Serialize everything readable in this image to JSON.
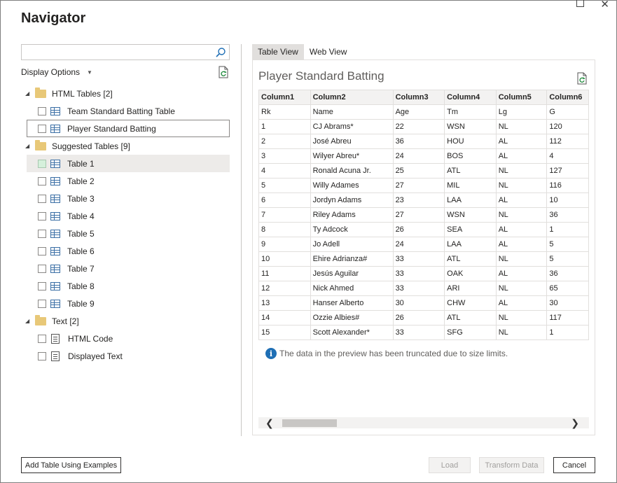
{
  "window": {
    "title": "Navigator",
    "maximize_glyph": "☐",
    "close_glyph": "✕"
  },
  "search": {
    "placeholder": "",
    "value": ""
  },
  "display_options": {
    "label": "Display Options"
  },
  "tree": {
    "html_tables": {
      "label": "HTML Tables [2]",
      "items": [
        "Team Standard Batting Table",
        "Player Standard Batting"
      ]
    },
    "suggested_tables": {
      "label": "Suggested Tables [9]",
      "items": [
        "Table 1",
        "Table 2",
        "Table 3",
        "Table 4",
        "Table 5",
        "Table 6",
        "Table 7",
        "Table 8",
        "Table 9"
      ]
    },
    "text": {
      "label": "Text [2]",
      "items": [
        "HTML Code",
        "Displayed Text"
      ]
    }
  },
  "tabs": {
    "table_view": "Table View",
    "web_view": "Web View"
  },
  "preview": {
    "title": "Player Standard Batting",
    "columns": [
      "Column1",
      "Column2",
      "Column3",
      "Column4",
      "Column5",
      "Column6"
    ],
    "rows": [
      [
        "Rk",
        "Name",
        "Age",
        "Tm",
        "Lg",
        "G"
      ],
      [
        "1",
        "CJ Abrams*",
        "22",
        "WSN",
        "NL",
        "120"
      ],
      [
        "2",
        "José Abreu",
        "36",
        "HOU",
        "AL",
        "112"
      ],
      [
        "3",
        "Wilyer Abreu*",
        "24",
        "BOS",
        "AL",
        "4"
      ],
      [
        "4",
        "Ronald Acuna Jr.",
        "25",
        "ATL",
        "NL",
        "127"
      ],
      [
        "5",
        "Willy Adames",
        "27",
        "MIL",
        "NL",
        "116"
      ],
      [
        "6",
        "Jordyn Adams",
        "23",
        "LAA",
        "AL",
        "10"
      ],
      [
        "7",
        "Riley Adams",
        "27",
        "WSN",
        "NL",
        "36"
      ],
      [
        "8",
        "Ty Adcock",
        "26",
        "SEA",
        "AL",
        "1"
      ],
      [
        "9",
        "Jo Adell",
        "24",
        "LAA",
        "AL",
        "5"
      ],
      [
        "10",
        "Ehire Adrianza#",
        "33",
        "ATL",
        "NL",
        "5"
      ],
      [
        "11",
        "Jesús Aguilar",
        "33",
        "OAK",
        "AL",
        "36"
      ],
      [
        "12",
        "Nick Ahmed",
        "33",
        "ARI",
        "NL",
        "65"
      ],
      [
        "13",
        "Hanser Alberto",
        "30",
        "CHW",
        "AL",
        "30"
      ],
      [
        "14",
        "Ozzie Albies#",
        "26",
        "ATL",
        "NL",
        "117"
      ],
      [
        "15",
        "Scott Alexander*",
        "33",
        "SFG",
        "NL",
        "1"
      ]
    ],
    "info_text": "The data in the preview has been truncated due to size limits.",
    "info_glyph": "i"
  },
  "buttons": {
    "add_table": "Add Table Using Examples",
    "load": "Load",
    "transform": "Transform Data",
    "cancel": "Cancel"
  },
  "glyphs": {
    "expanded": "◢",
    "caret": "▼",
    "scroll_left": "❮",
    "scroll_right": "❯"
  },
  "colors": {
    "accent": "#1f6fb5",
    "folder": "#e8c878",
    "selected_check": "#d5f0db"
  }
}
